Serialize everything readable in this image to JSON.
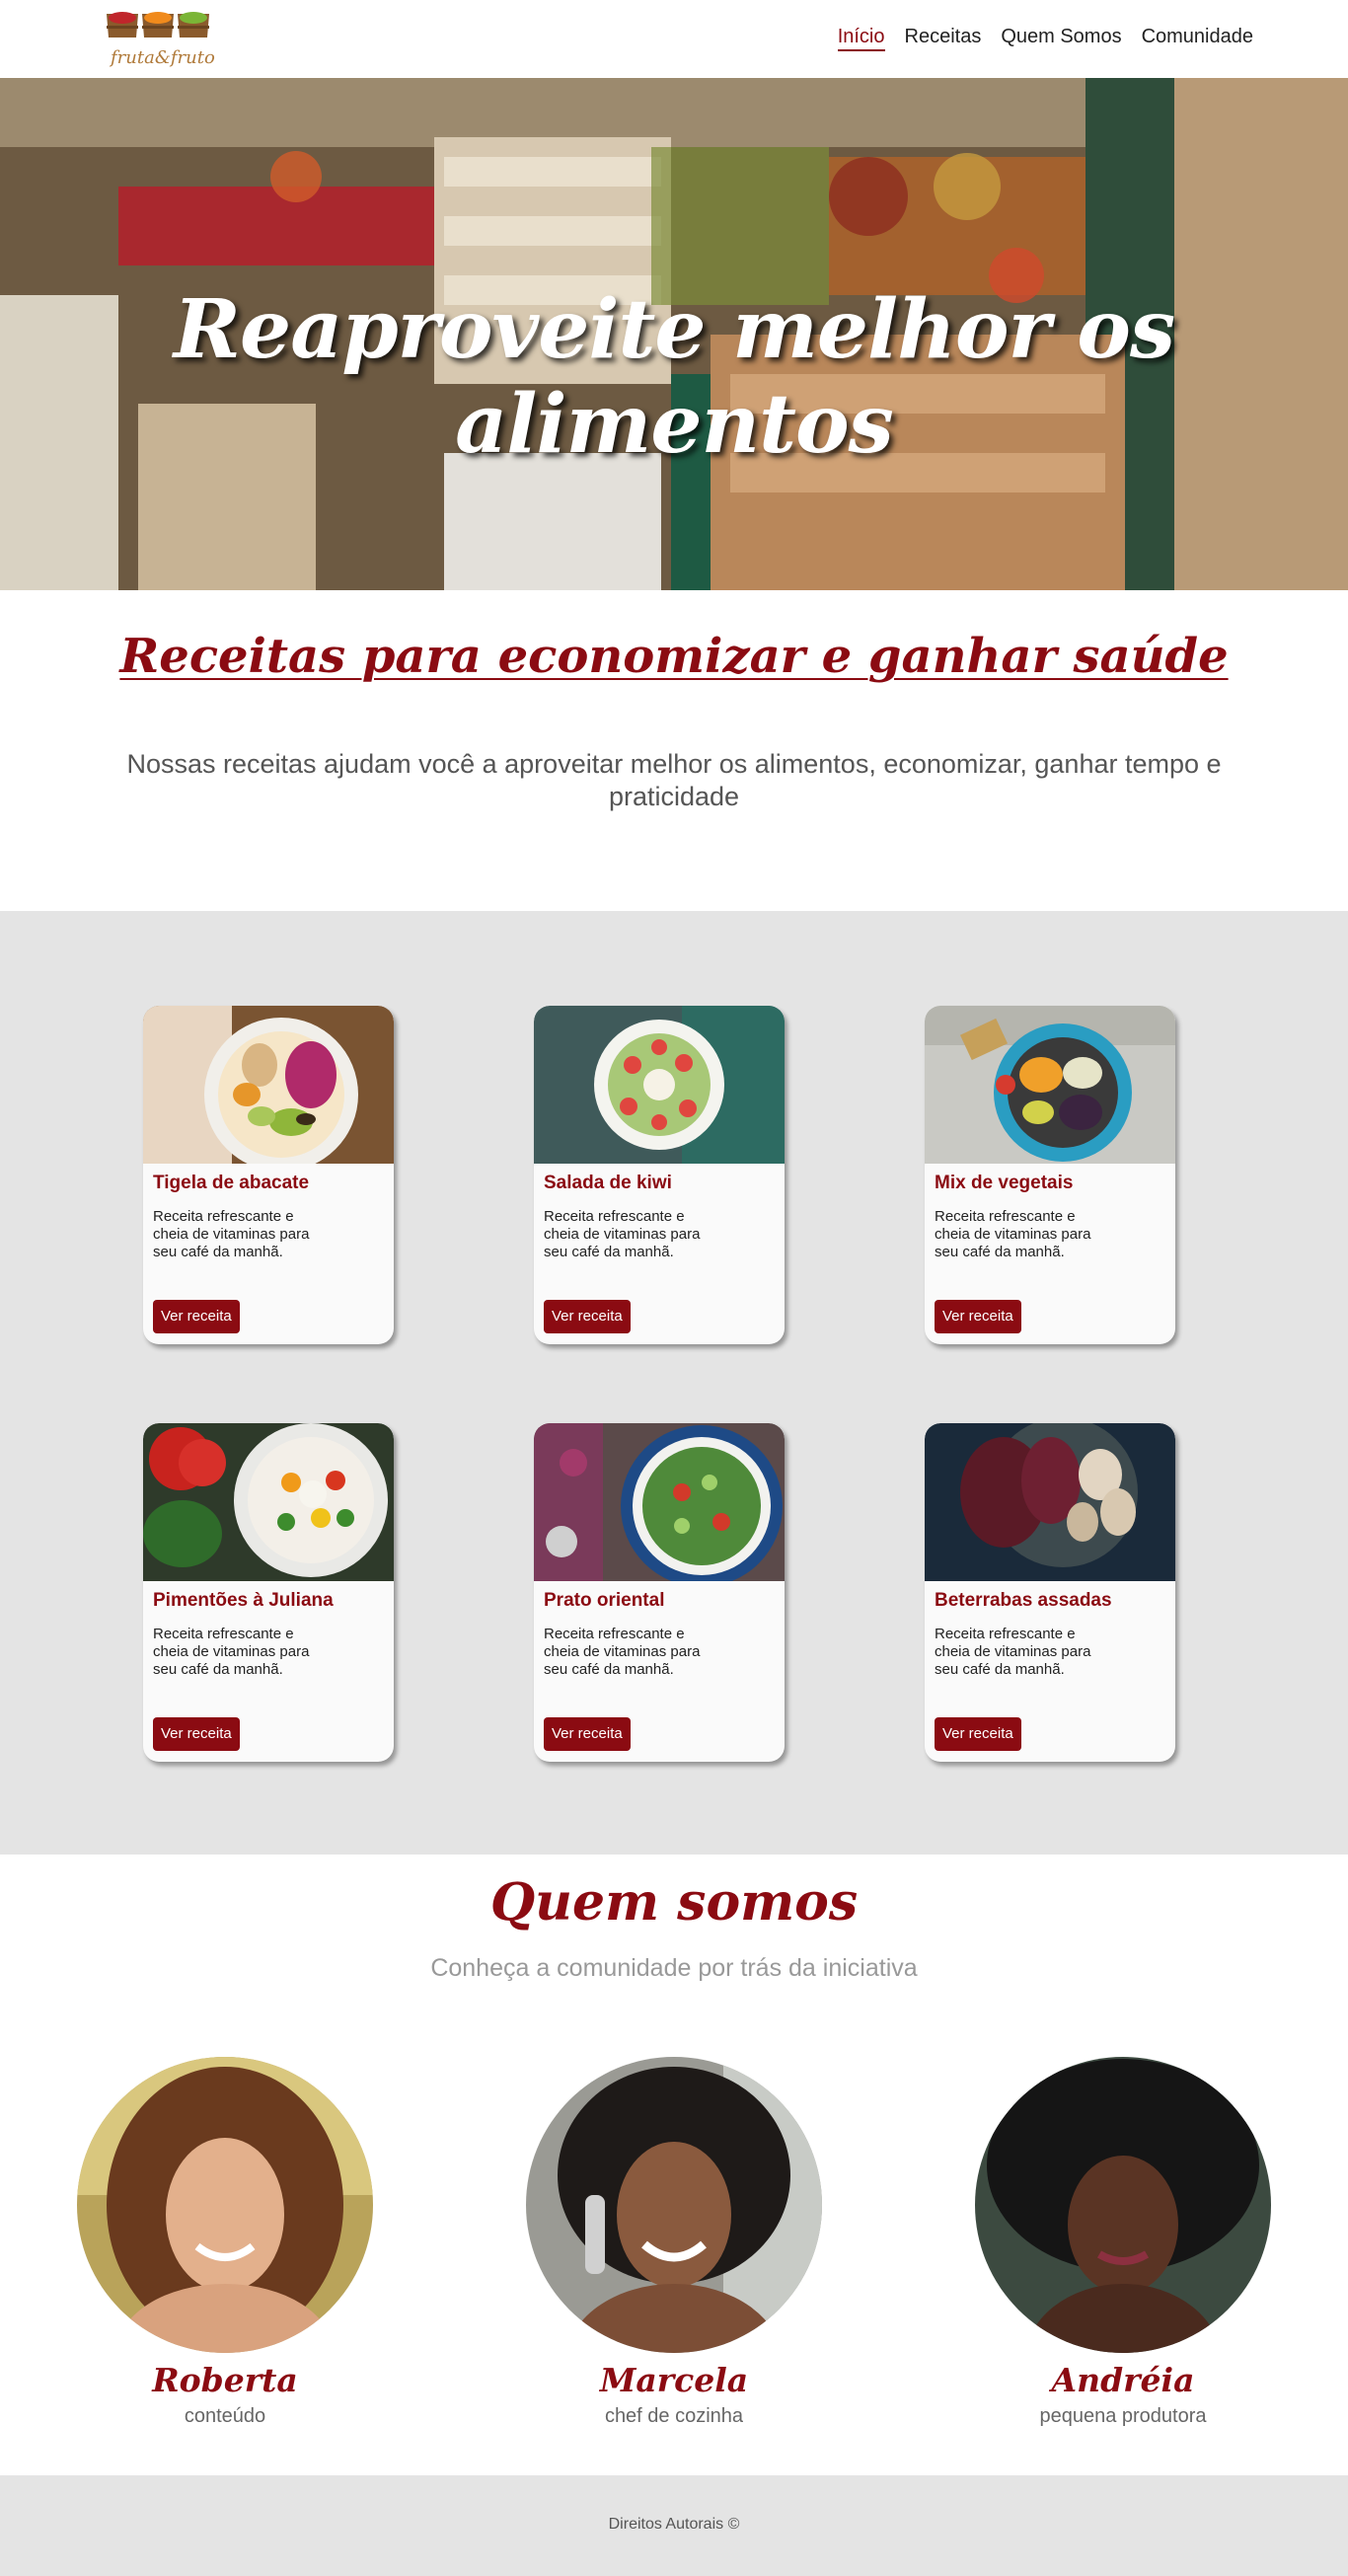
{
  "header": {
    "logo_text": "fruta&fruto",
    "nav": [
      {
        "label": "Início",
        "active": true
      },
      {
        "label": "Receitas",
        "active": false
      },
      {
        "label": "Quem Somos",
        "active": false
      },
      {
        "label": "Comunidade",
        "active": false
      }
    ]
  },
  "hero": {
    "title": "Reaproveite melhor os alimentos"
  },
  "intro": {
    "title": "Receitas para economizar e ganhar saúde",
    "text": "Nossas receitas ajudam você a aproveitar melhor os alimentos, economizar, ganhar tempo e praticidade"
  },
  "recipes": [
    {
      "title": "Tigela de abacate",
      "description": "Receita refrescante e cheia de vitaminas para seu café da manhã.",
      "button": "Ver receita"
    },
    {
      "title": "Salada de kiwi",
      "description": "Receita refrescante e cheia de vitaminas para seu café da manhã.",
      "button": "Ver receita"
    },
    {
      "title": "Mix de vegetais",
      "description": "Receita refrescante e cheia de vitaminas para seu café da manhã.",
      "button": "Ver receita"
    },
    {
      "title": "Pimentões à Juliana",
      "description": "Receita refrescante e cheia de vitaminas para seu café da manhã.",
      "button": "Ver receita"
    },
    {
      "title": "Prato oriental",
      "description": "Receita refrescante e cheia de vitaminas para seu café da manhã.",
      "button": "Ver receita"
    },
    {
      "title": "Beterrabas assadas",
      "description": "Receita refrescante e cheia de vitaminas para seu café da manhã.",
      "button": "Ver receita"
    }
  ],
  "about": {
    "title": "Quem somos",
    "subtitle": "Conheça a comunidade por trás da iniciativa",
    "members": [
      {
        "name": "Roberta",
        "role": "conteúdo"
      },
      {
        "name": "Marcela",
        "role": "chef de cozinha"
      },
      {
        "name": "Andréia",
        "role": "pequena produtora"
      }
    ]
  },
  "footer": {
    "text": "Direitos Autorais ©"
  },
  "colors": {
    "accent": "#8b0b12",
    "section_bg": "#e4e4e4",
    "card_bg": "#fafafa"
  }
}
